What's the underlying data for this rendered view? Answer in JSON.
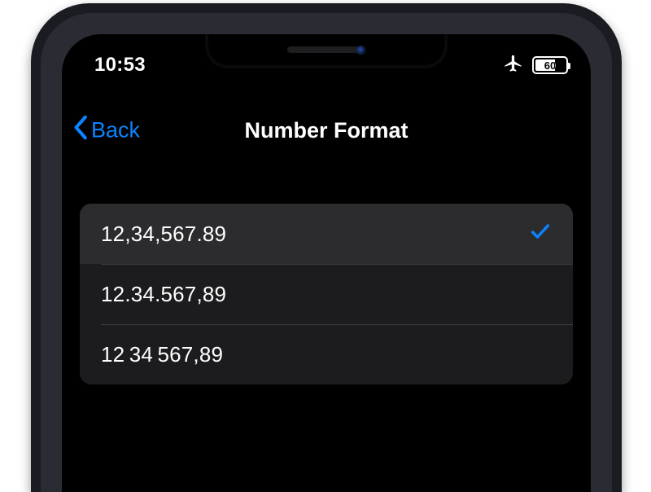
{
  "status": {
    "time": "10:53",
    "battery_percent": "60"
  },
  "nav": {
    "back_label": "Back",
    "title": "Number Format"
  },
  "options": [
    {
      "label": "12,34,567.89",
      "selected": true
    },
    {
      "label": "12.34.567,89",
      "selected": false
    },
    {
      "label": "12 34 567,89",
      "selected": false
    }
  ],
  "colors": {
    "accent": "#0a84ff",
    "row_bg": "#1c1c1e",
    "row_selected_bg": "#2c2c2e"
  }
}
